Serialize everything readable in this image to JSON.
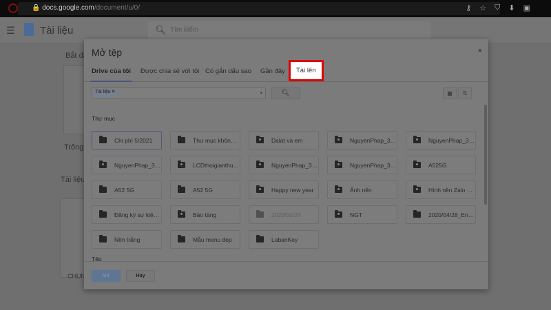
{
  "browser": {
    "url_host": "docs.google.com",
    "url_path": "/document/u/0/"
  },
  "app": {
    "title": "Tài liệu",
    "search_placeholder": "Tìm kiếm",
    "bg_start": "Bắt đầ",
    "bg_blank": "Trống",
    "bg_recent": "Tài liệu g",
    "bg_doc": "CHUN"
  },
  "dialog": {
    "title": "Mở tệp",
    "close": "×",
    "tabs": [
      "Drive của tôi",
      "Được chia sẻ với tôi",
      "Có gắn dấu sao",
      "Gần đây",
      "Tải lên"
    ],
    "filter_chip": "Tài liệu",
    "folders_heading": "Thư mục",
    "files_heading": "Tệp",
    "folders": [
      {
        "name": "Chi phí 5/2021",
        "icon": "folder"
      },
      {
        "name": "Thư mục không ...",
        "icon": "folder"
      },
      {
        "name": "Dalat và em",
        "icon": "shared-folder"
      },
      {
        "name": "NguyenPhap_31...",
        "icon": "shared-folder"
      },
      {
        "name": "NguyenPhap_31...",
        "icon": "shared-folder"
      },
      {
        "name": "NguyenPhap_31...",
        "icon": "shared-folder"
      },
      {
        "name": "LCDthoigianthuc...",
        "icon": "shared-folder"
      },
      {
        "name": "NguyenPhap_31...",
        "icon": "shared-folder"
      },
      {
        "name": "NguyenPhap_31...",
        "icon": "shared-folder"
      },
      {
        "name": "A525G",
        "icon": "shared-folder"
      },
      {
        "name": "A52 5G",
        "icon": "folder"
      },
      {
        "name": "A52 5G",
        "icon": "folder"
      },
      {
        "name": "Happy new year",
        "icon": "shared-folder"
      },
      {
        "name": "Ảnh nền",
        "icon": "shared-folder"
      },
      {
        "name": "Hình nền Zalo N...",
        "icon": "shared-folder"
      },
      {
        "name": "Đăng ký sự kiện ...",
        "icon": "folder"
      },
      {
        "name": "Bảo tàng",
        "icon": "shared-folder"
      },
      {
        "name": "2020/05/24",
        "icon": "shortcut-folder",
        "dim": true
      },
      {
        "name": "NGT",
        "icon": "shared-folder"
      },
      {
        "name": "2020/04/28_Env...",
        "icon": "shortcut-folder"
      },
      {
        "name": "Nền trắng",
        "icon": "shortcut-folder"
      },
      {
        "name": "Mẫu menu đẹp",
        "icon": "shortcut-folder"
      },
      {
        "name": "LabanKey",
        "icon": "folder"
      }
    ],
    "open_button": "Mở",
    "cancel_button": "Hủy"
  },
  "colors": {
    "highlight_border": "#e00000",
    "open_button": "#5f7594"
  }
}
